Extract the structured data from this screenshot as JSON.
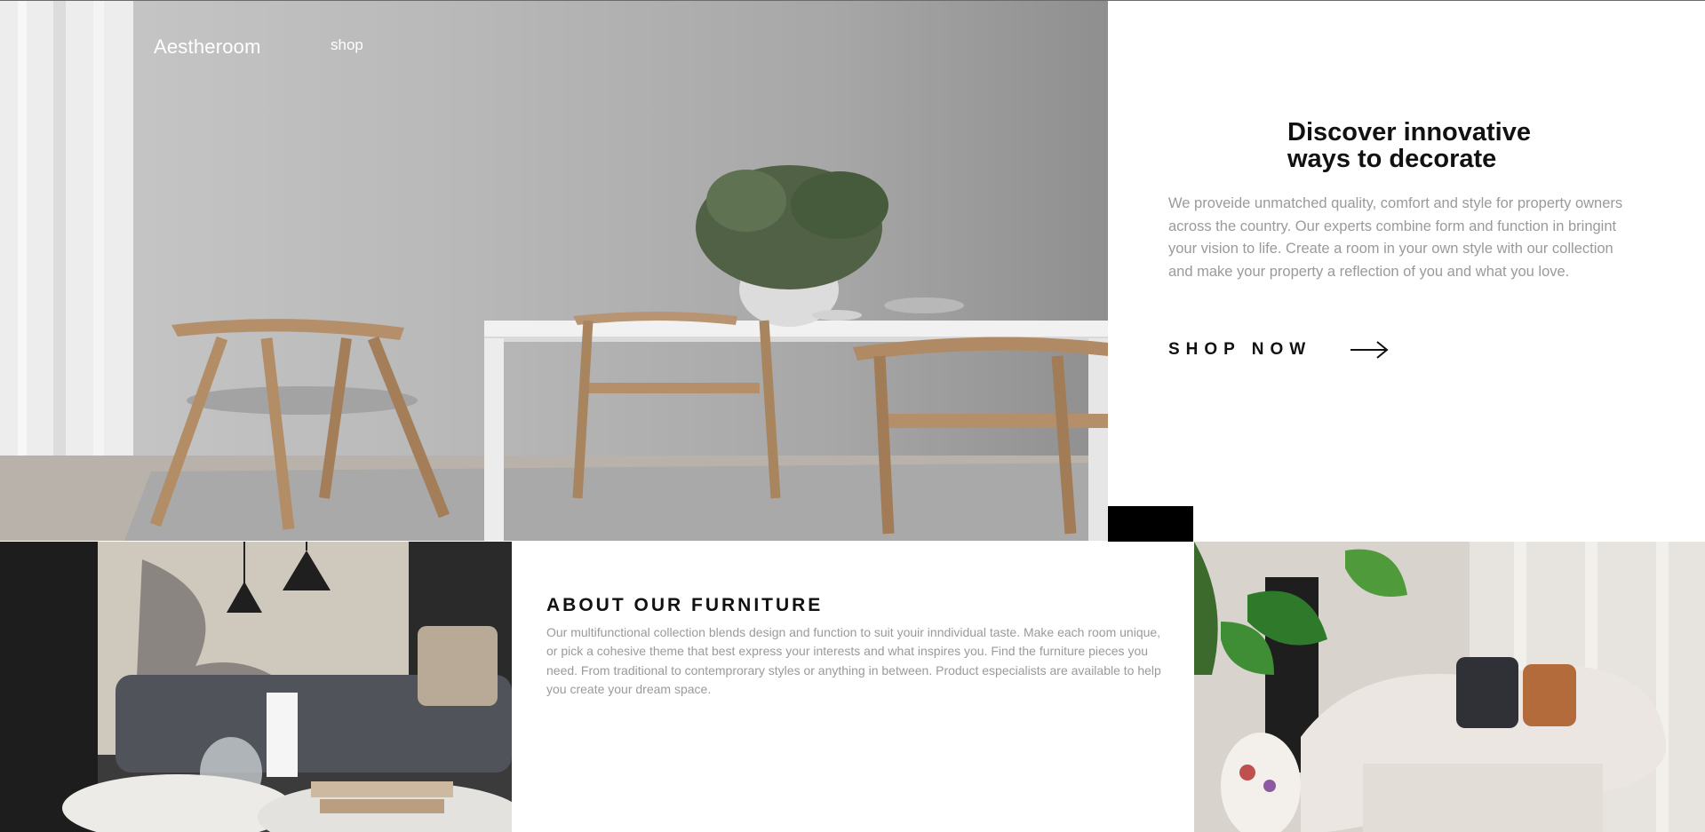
{
  "header": {
    "brand": "Aestheroom",
    "nav": {
      "shop": "shop"
    }
  },
  "hero": {
    "image_subject": "dining-room-photo",
    "title": "Discover innovative ways to decorate",
    "description": "We proveide unmatched quality, comfort and style for property owners across the country. Our experts combine form and function in bringint your vision to life. Create a room in your own style with our collection and make your property a reflection of you and what you love.",
    "cta_label": "SHOP NOW",
    "cta_icon": "arrow-right-icon"
  },
  "about": {
    "title": "ABOUT OUR FURNITURE",
    "description": "Our multifunctional collection blends design and function to suit youir inndividual taste. Make each room unique, or pick a cohesive theme that best express your interests and what inspires you. Find the furniture pieces you need. From traditional to contemprorary styles or anything in between. Product especialists are available to help you create your dream space."
  },
  "colors": {
    "heading": "#111111",
    "body_text": "#9a9a9a",
    "background": "#ffffff",
    "accent_block": "#000000"
  }
}
